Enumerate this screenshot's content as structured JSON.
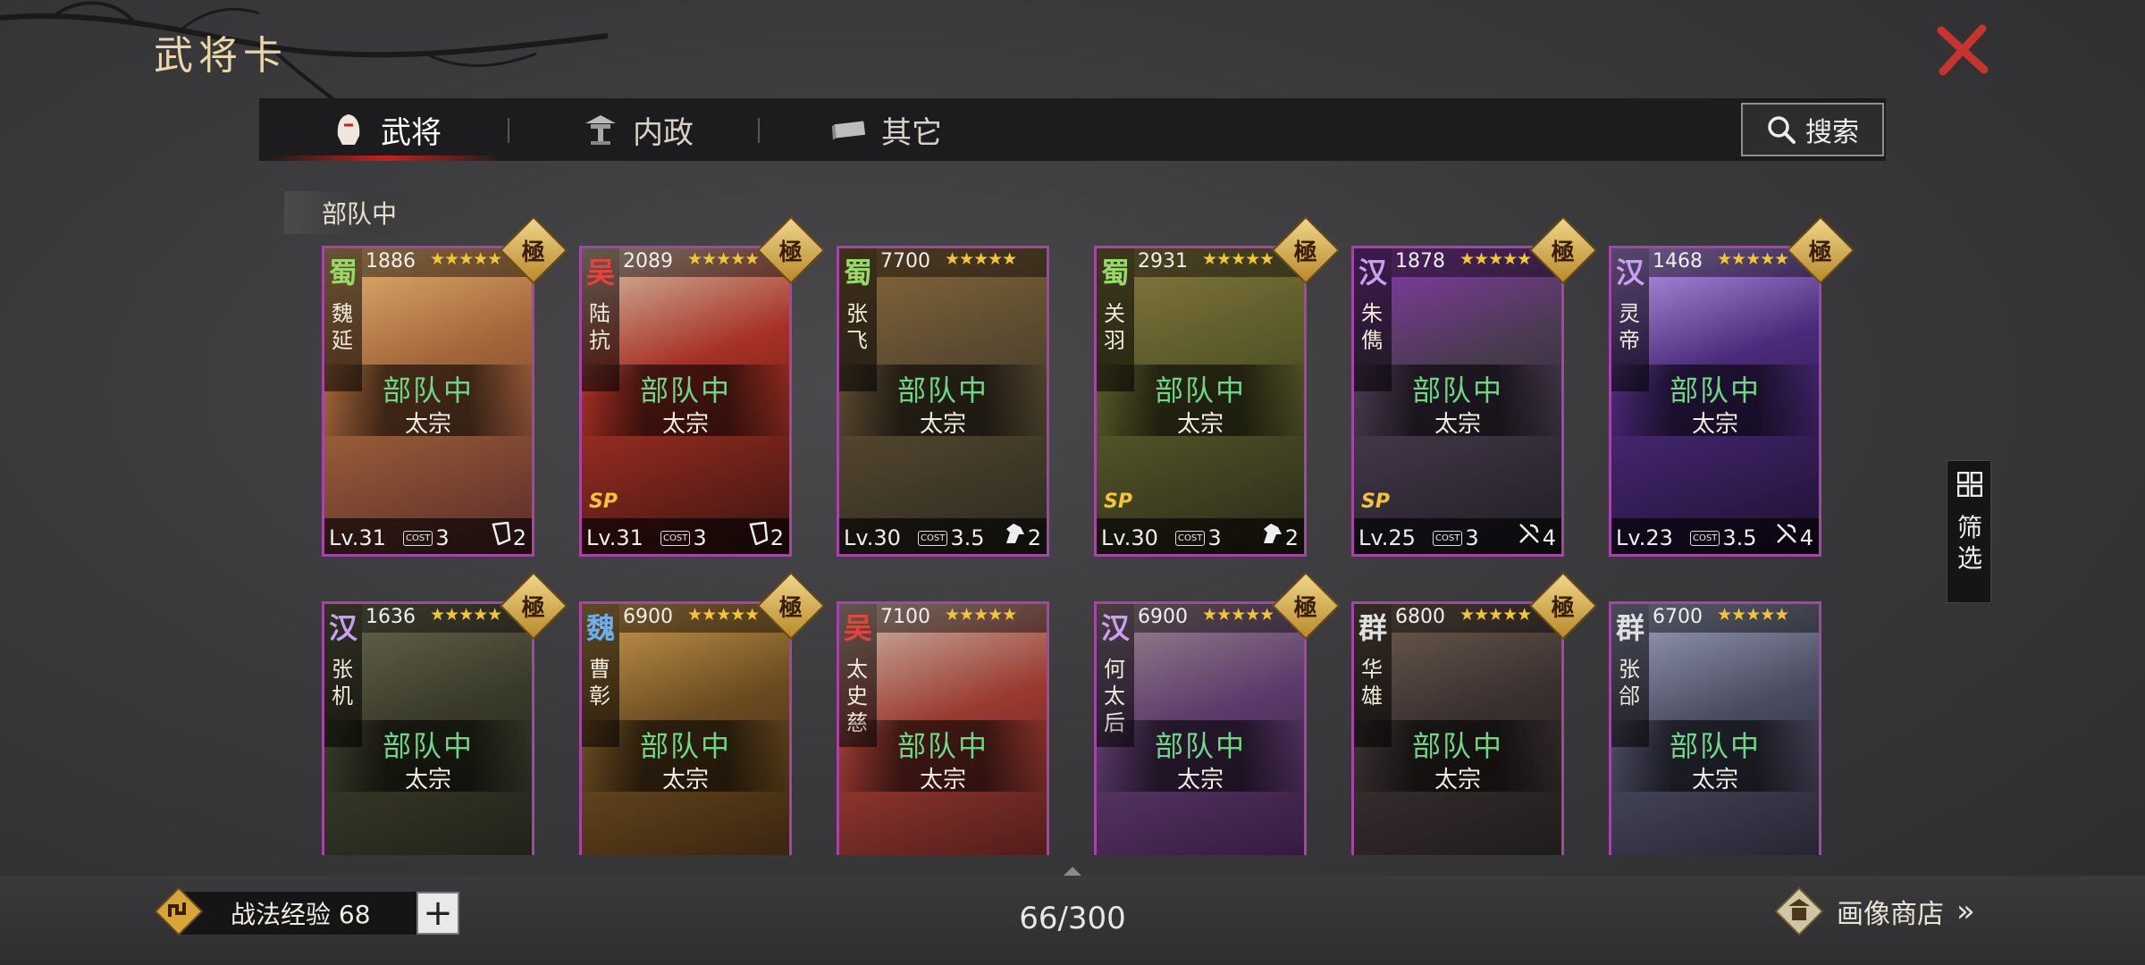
{
  "title": "武将卡",
  "tabs": [
    {
      "label": "武将",
      "icon": "helmet-icon",
      "active": true
    },
    {
      "label": "内政",
      "icon": "pavilion-icon",
      "active": false
    },
    {
      "label": "其它",
      "icon": "ingot-icon",
      "active": false
    }
  ],
  "search": {
    "label": "搜索",
    "icon": "search-icon"
  },
  "section": {
    "label": "部队中"
  },
  "filter": {
    "label": "筛选"
  },
  "colors": {
    "status_green": "#6fd686",
    "card_border": "#a645a8",
    "close_red": "#c8332e",
    "star_gold": "#f2c43a"
  },
  "cards": [
    {
      "faction": "蜀",
      "faction_color": "#9bd86a",
      "name": "魏延",
      "power": "1886",
      "stars": "★★★★★",
      "status": "部队中",
      "sub": "太宗",
      "level": "Lv.31",
      "cost": "3",
      "troop_count": "2",
      "troop_icon": "shield-icon",
      "sp": "",
      "badge": "極"
    },
    {
      "faction": "吴",
      "faction_color": "#e6433a",
      "name": "陆抗",
      "power": "2089",
      "stars": "★★★★★",
      "status": "部队中",
      "sub": "太宗",
      "level": "Lv.31",
      "cost": "3",
      "troop_count": "2",
      "troop_icon": "shield-icon",
      "sp": "SP",
      "badge": "極"
    },
    {
      "faction": "蜀",
      "faction_color": "#9bd86a",
      "name": "张飞",
      "power": "7700",
      "stars": "★★★★★",
      "status": "部队中",
      "sub": "太宗",
      "level": "Lv.30",
      "cost": "3.5",
      "troop_count": "2",
      "troop_icon": "horse-icon",
      "sp": "",
      "badge": ""
    },
    {
      "faction": "蜀",
      "faction_color": "#9bd86a",
      "name": "关羽",
      "power": "2931",
      "stars": "★★★★★",
      "status": "部队中",
      "sub": "太宗",
      "level": "Lv.30",
      "cost": "3",
      "troop_count": "2",
      "troop_icon": "horse-icon",
      "sp": "SP",
      "badge": "極"
    },
    {
      "faction": "汉",
      "faction_color": "#c9a0f0",
      "name": "朱儁",
      "power": "1878",
      "stars": "★★★★★",
      "status": "部队中",
      "sub": "太宗",
      "level": "Lv.25",
      "cost": "3",
      "troop_count": "4",
      "troop_icon": "crossbow-icon",
      "sp": "SP",
      "badge": "極"
    },
    {
      "faction": "汉",
      "faction_color": "#c9a0f0",
      "name": "灵帝",
      "power": "1468",
      "stars": "★★★★★",
      "status": "部队中",
      "sub": "太宗",
      "level": "Lv.23",
      "cost": "3.5",
      "troop_count": "4",
      "troop_icon": "crossbow-icon",
      "sp": "",
      "badge": "極"
    },
    {
      "faction": "汉",
      "faction_color": "#c9a0f0",
      "name": "张机",
      "power": "1636",
      "stars": "★★★★★",
      "status": "部队中",
      "sub": "太宗",
      "badge": "極"
    },
    {
      "faction": "魏",
      "faction_color": "#6ab0f0",
      "name": "曹彰",
      "power": "6900",
      "stars": "★★★★★",
      "status": "部队中",
      "sub": "太宗",
      "badge": "極"
    },
    {
      "faction": "吴",
      "faction_color": "#e6433a",
      "name": "太史慈",
      "power": "7100",
      "stars": "★★★★★",
      "status": "部队中",
      "sub": "太宗",
      "badge": ""
    },
    {
      "faction": "汉",
      "faction_color": "#c9a0f0",
      "name": "何太后",
      "power": "6900",
      "stars": "★★★★★",
      "status": "部队中",
      "sub": "太宗",
      "badge": "極"
    },
    {
      "faction": "群",
      "faction_color": "#e0e0e0",
      "name": "华雄",
      "power": "6800",
      "stars": "★★★★★",
      "status": "部队中",
      "sub": "太宗",
      "badge": "極"
    },
    {
      "faction": "群",
      "faction_color": "#e0e0e0",
      "name": "张郃",
      "power": "6700",
      "stars": "★★★★★",
      "status": "部队中",
      "sub": "太宗",
      "badge": ""
    }
  ],
  "footer": {
    "exp_label": "战法经验 68",
    "plus": "+",
    "count": "66/300",
    "shop_label": "画像商店",
    "shop_arrow": "»"
  }
}
